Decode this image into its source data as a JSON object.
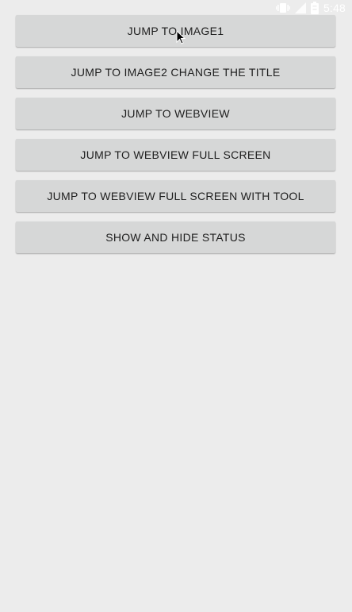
{
  "status_bar": {
    "time": "5:48",
    "icons": [
      "vibrate-icon",
      "signal-icon",
      "battery-icon"
    ]
  },
  "buttons": [
    {
      "label": "JUMP TO IMAGE1"
    },
    {
      "label": "JUMP TO IMAGE2 CHANGE THE TITLE"
    },
    {
      "label": "JUMP TO WEBVIEW"
    },
    {
      "label": "JUMP TO WEBVIEW FULL SCREEN"
    },
    {
      "label": "JUMP TO WEBVIEW FULL SCREEN WITH TOOL"
    },
    {
      "label": "SHOW AND HIDE STATUS"
    }
  ],
  "colors": {
    "background": "#ececec",
    "button_bg": "#d6d7d7",
    "button_text": "#1e1e1e",
    "status_icons": "#ffffff"
  }
}
